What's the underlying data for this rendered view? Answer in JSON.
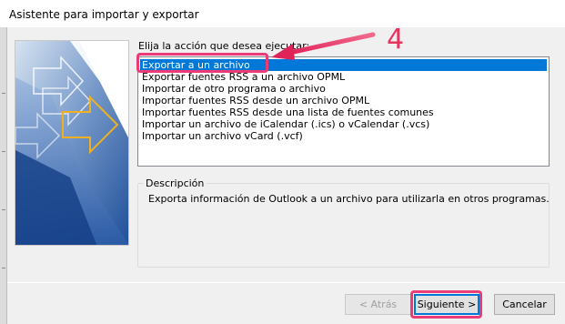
{
  "window": {
    "title": "Asistente para importar y exportar"
  },
  "prompt": "Elija la acción que desea ejecutar:",
  "actions": [
    {
      "label": "Exportar a un archivo",
      "selected": true
    },
    {
      "label": "Exportar fuentes RSS a un archivo OPML",
      "selected": false
    },
    {
      "label": "Importar de otro programa o archivo",
      "selected": false
    },
    {
      "label": "Importar fuentes RSS desde un archivo OPML",
      "selected": false
    },
    {
      "label": "Importar fuentes RSS desde una lista de fuentes comunes",
      "selected": false
    },
    {
      "label": "Importar un archivo de iCalendar (.ics) o vCalendar (.vcs)",
      "selected": false
    },
    {
      "label": "Importar un archivo vCard (.vcf)",
      "selected": false
    }
  ],
  "description": {
    "legend": "Descripción",
    "text": "Exporta información de Outlook a un archivo para utilizarla en otros programas."
  },
  "buttons": {
    "back": "< Atrás",
    "next": "Siguiente >",
    "cancel": "Cancelar"
  },
  "annotation": {
    "step": "4",
    "color": "#e8335f"
  },
  "colors": {
    "selection": "#0078d7",
    "highlight": "#ec3c78"
  }
}
